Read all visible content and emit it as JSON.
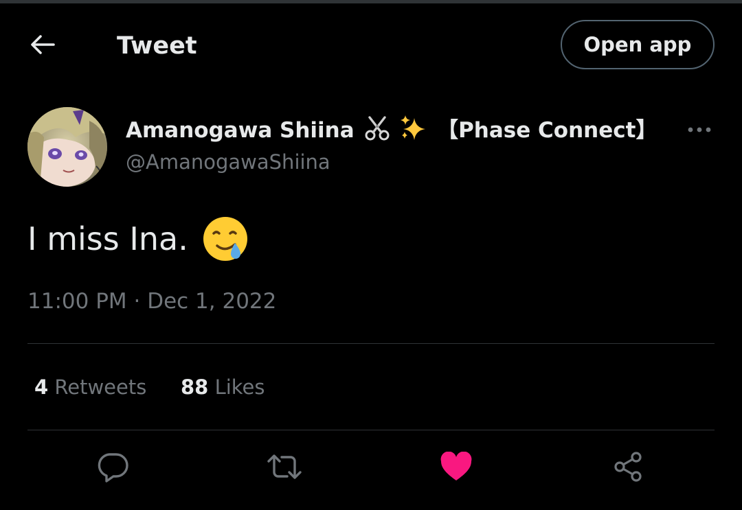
{
  "header": {
    "title": "Tweet",
    "open_app_label": "Open app"
  },
  "author": {
    "display_name": "Amanogawa Shiina",
    "display_name_suffix": "【Phase Connect】",
    "handle": "@AmanogawaShiina",
    "name_emojis": [
      "scissors-icon",
      "sparkles-icon"
    ]
  },
  "tweet": {
    "text": "I miss Ina.",
    "emoji": "face-holding-back-tears",
    "time": "11:00 PM",
    "separator": "·",
    "date": "Dec 1, 2022"
  },
  "stats": {
    "retweets_count": "4",
    "retweets_label": "Retweets",
    "likes_count": "88",
    "likes_label": "Likes"
  },
  "actions": {
    "reply_icon": "reply-icon",
    "retweet_icon": "retweet-icon",
    "like_icon": "heart-filled-icon",
    "share_icon": "share-icon",
    "liked": true
  },
  "colors": {
    "background": "#000000",
    "primary_text": "#e7e9ea",
    "secondary_text": "#71767b",
    "divider": "#2f3336",
    "like_active": "#f91880"
  }
}
